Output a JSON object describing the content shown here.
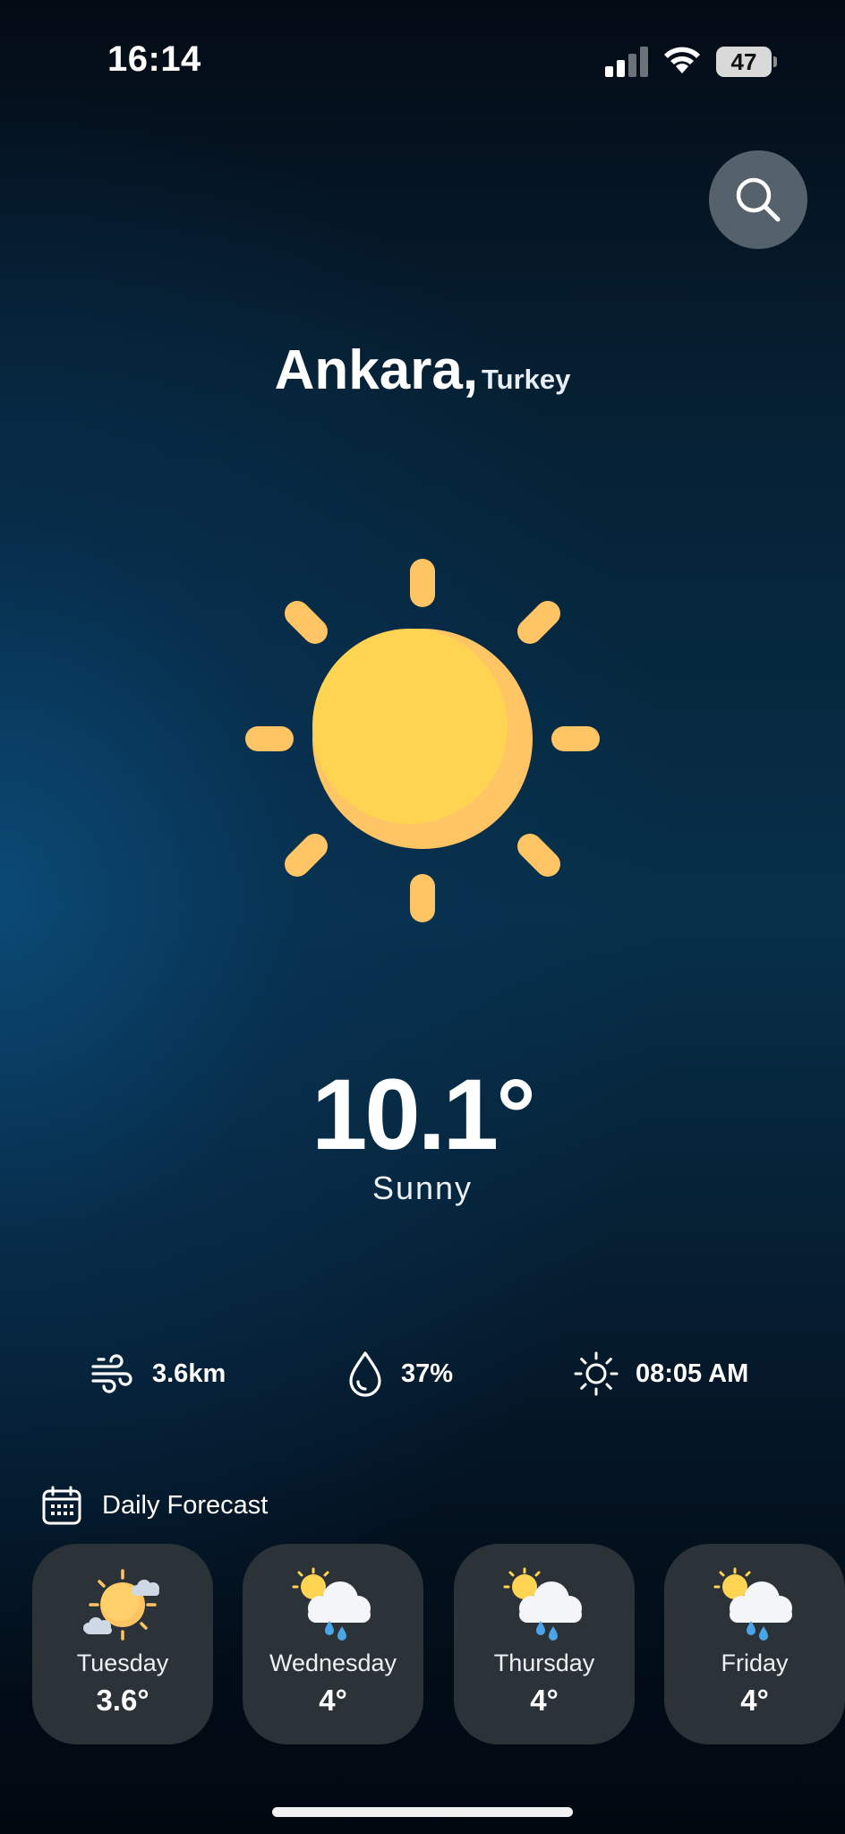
{
  "status_bar": {
    "time": "16:14",
    "battery": "47"
  },
  "search": {
    "label": "Search"
  },
  "location": {
    "city": "Ankara,",
    "country": "Turkey"
  },
  "current": {
    "temperature": "10.1°",
    "condition": "Sunny",
    "icon": "sun-icon"
  },
  "metrics": {
    "wind": {
      "icon": "wind-icon",
      "value": "3.6km"
    },
    "humidity": {
      "icon": "droplet-icon",
      "value": "37%"
    },
    "sunrise": {
      "icon": "sun-outline-icon",
      "value": "08:05 AM"
    }
  },
  "forecast": {
    "title": "Daily Forecast",
    "days": [
      {
        "day": "Tuesday",
        "temp": "3.6°",
        "icon": "partly-sunny-icon"
      },
      {
        "day": "Wednesday",
        "temp": "4°",
        "icon": "sun-rain-cloud-icon"
      },
      {
        "day": "Thursday",
        "temp": "4°",
        "icon": "sun-rain-cloud-icon"
      },
      {
        "day": "Friday",
        "temp": "4°",
        "icon": "sun-rain-cloud-icon"
      }
    ]
  },
  "colors": {
    "sun": "#ffd452",
    "sun_shade": "#ffc463",
    "card": "#2b3238",
    "search_bg": "#55616b"
  }
}
